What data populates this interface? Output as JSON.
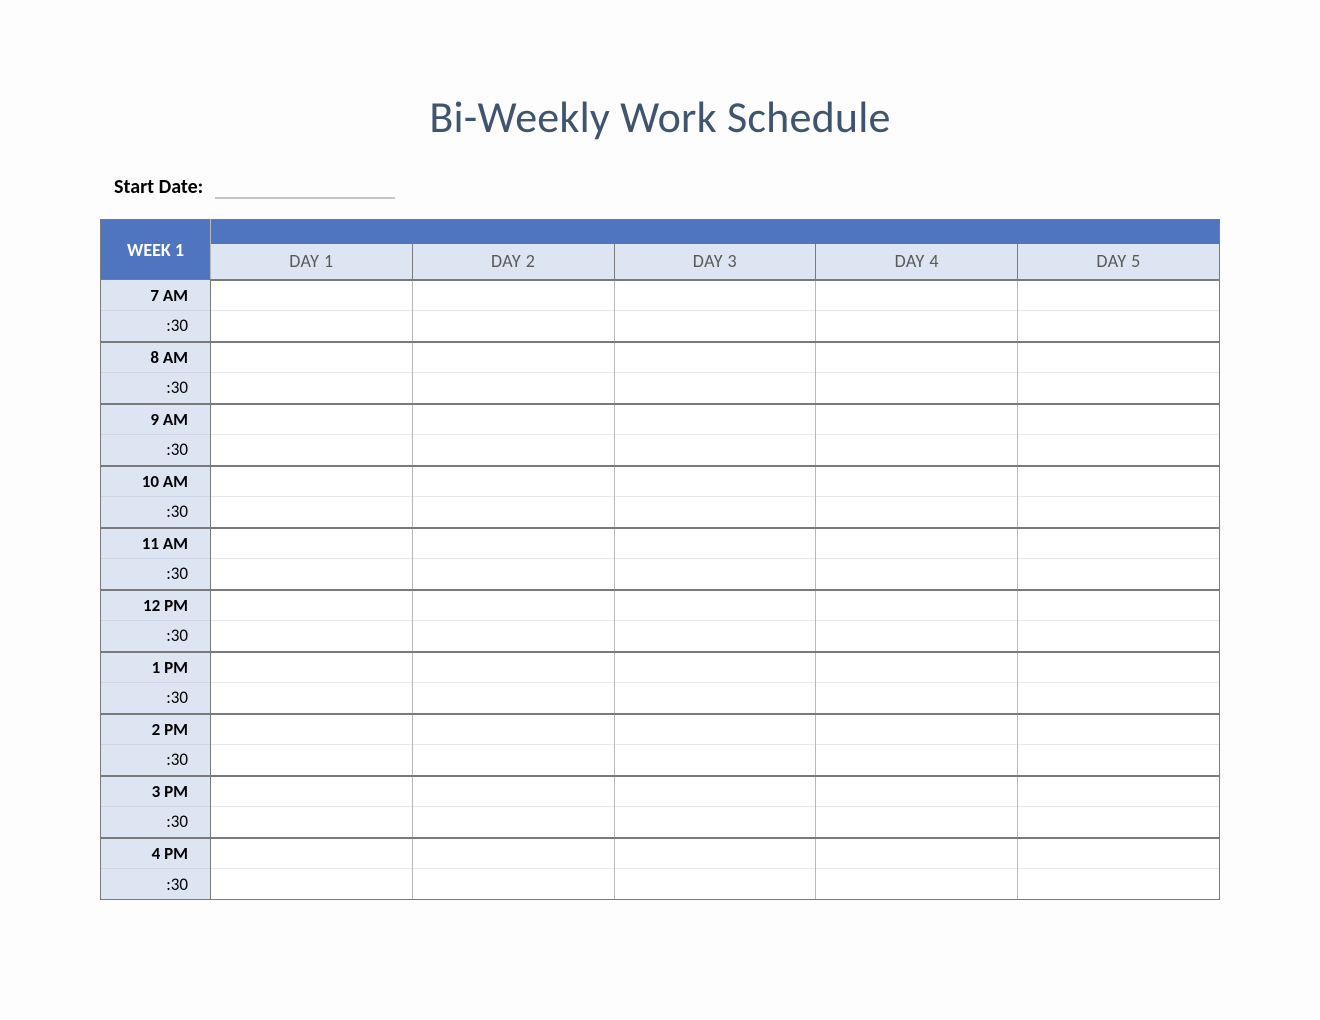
{
  "title": "Bi-Weekly Work Schedule",
  "start_date": {
    "label": "Start Date:",
    "value": ""
  },
  "week_label": "WEEK 1",
  "days": [
    "DAY 1",
    "DAY 2",
    "DAY 3",
    "DAY 4",
    "DAY 5"
  ],
  "times": [
    {
      "hour": "7 AM",
      "half": ":30"
    },
    {
      "hour": "8 AM",
      "half": ":30"
    },
    {
      "hour": "9 AM",
      "half": ":30"
    },
    {
      "hour": "10 AM",
      "half": ":30"
    },
    {
      "hour": "11 AM",
      "half": ":30"
    },
    {
      "hour": "12 PM",
      "half": ":30"
    },
    {
      "hour": "1 PM",
      "half": ":30"
    },
    {
      "hour": "2 PM",
      "half": ":30"
    },
    {
      "hour": "3 PM",
      "half": ":30"
    },
    {
      "hour": "4 PM",
      "half": ":30"
    }
  ]
}
